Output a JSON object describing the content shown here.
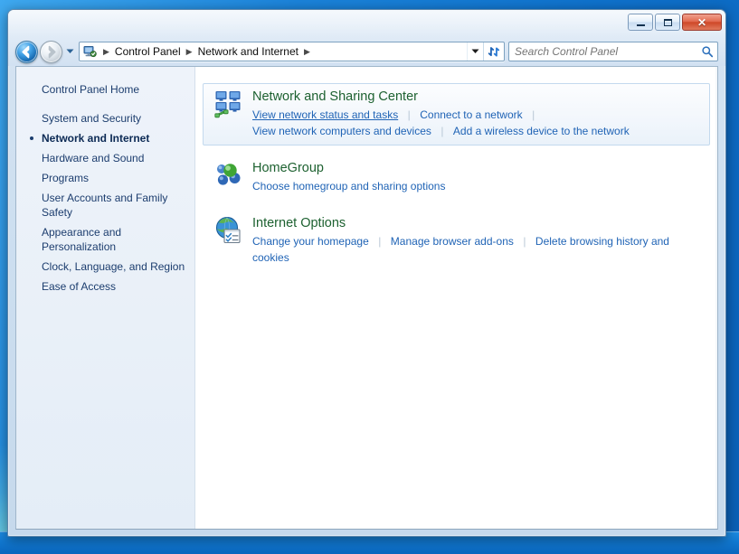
{
  "window": {
    "buttons": {
      "minimize": "Minimize",
      "maximize": "Maximize",
      "close": "Close",
      "close_glyph": "✕"
    }
  },
  "nav": {
    "back_label": "Back",
    "forward_label": "Forward",
    "history_label": "Recent pages",
    "refresh_label": "Refresh",
    "dropdown_label": "Previous locations"
  },
  "address": {
    "icon": "control-panel-icon",
    "crumbs": [
      {
        "label": "Control Panel"
      },
      {
        "label": "Network and Internet"
      }
    ],
    "separator": "▶"
  },
  "search": {
    "placeholder": "Search Control Panel",
    "value": "",
    "icon": "search-icon"
  },
  "sidebar": {
    "items": [
      {
        "label": "Control Panel Home",
        "active": false,
        "home": true
      },
      {
        "label": "System and Security",
        "active": false
      },
      {
        "label": "Network and Internet",
        "active": true
      },
      {
        "label": "Hardware and Sound",
        "active": false
      },
      {
        "label": "Programs",
        "active": false
      },
      {
        "label": "User Accounts and Family Safety",
        "active": false
      },
      {
        "label": "Appearance and Personalization",
        "active": false
      },
      {
        "label": "Clock, Language, and Region",
        "active": false
      },
      {
        "label": "Ease of Access",
        "active": false
      }
    ]
  },
  "main": {
    "categories": [
      {
        "icon": "network-sharing-center-icon",
        "title": "Network and Sharing Center",
        "hovered": true,
        "rows": [
          [
            {
              "label": "View network status and tasks",
              "hover": true
            },
            {
              "label": "Connect to a network",
              "hover": false
            }
          ],
          [
            {
              "label": "View network computers and devices",
              "hover": false
            },
            {
              "label": "Add a wireless device to the network",
              "hover": false
            }
          ]
        ]
      },
      {
        "icon": "homegroup-icon",
        "title": "HomeGroup",
        "hovered": false,
        "rows": [
          [
            {
              "label": "Choose homegroup and sharing options",
              "hover": false
            }
          ]
        ]
      },
      {
        "icon": "internet-options-icon",
        "title": "Internet Options",
        "hovered": false,
        "rows": [
          [
            {
              "label": "Change your homepage",
              "hover": false
            },
            {
              "label": "Manage browser add-ons",
              "hover": false
            },
            {
              "label": "Delete browsing history and cookies",
              "hover": false
            }
          ]
        ]
      }
    ]
  },
  "colors": {
    "category_title": "#1d6130",
    "task_link": "#1f63b5",
    "sidebar_text": "#1c3d6e",
    "close_button": "#cf4828",
    "desktop": "#1378d4"
  }
}
